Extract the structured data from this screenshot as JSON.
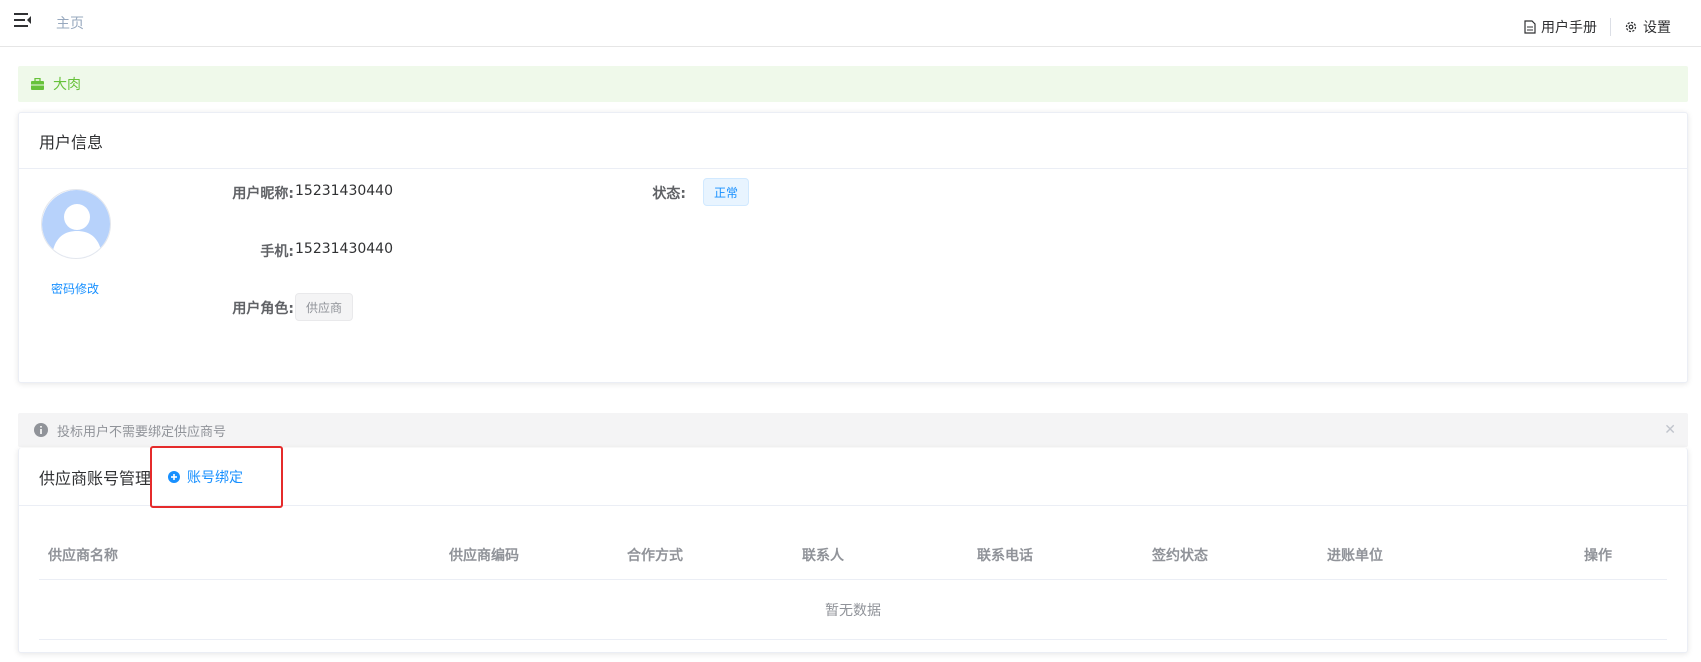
{
  "header": {
    "breadcrumb_home": "主页",
    "manual_label": "用户手册",
    "settings_label": "设置"
  },
  "banner": {
    "text": "大肉",
    "color": "#67c23a"
  },
  "user_info": {
    "title": "用户信息",
    "password_link": "密码修改",
    "nickname_label": "用户昵称:",
    "nickname_value": "15231430440",
    "status_label": "状态:",
    "status_value": "正常",
    "phone_label": "手机:",
    "phone_value": "15231430440",
    "role_label": "用户角色:",
    "role_value": "供应商"
  },
  "alert": {
    "text": "投标用户不需要绑定供应商号"
  },
  "supplier": {
    "title": "供应商账号管理",
    "bind_button": "账号绑定",
    "columns": [
      "供应商名称",
      "供应商编码",
      "合作方式",
      "联系人",
      "联系电话",
      "签约状态",
      "进账单位",
      "操作"
    ],
    "empty_text": "暂无数据"
  },
  "colors": {
    "accent": "#1890ff",
    "highlight": "#e52b2b"
  }
}
